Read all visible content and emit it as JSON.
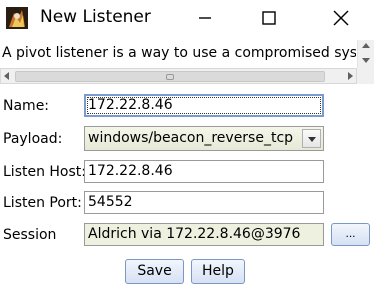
{
  "window": {
    "title": "New Listener",
    "icon": "app-icon",
    "controls": [
      "minimize-icon",
      "maximize-icon",
      "close-icon"
    ]
  },
  "description": {
    "text": "A pivot listener is a way to use a compromised system as"
  },
  "form": {
    "name_label": "Name:",
    "name_value": "172.22.8.46",
    "payload_label": "Payload:",
    "payload_value": "windows/beacon_reverse_tcp",
    "listen_host_label": "Listen Host:",
    "listen_host_value": "172.22.8.46",
    "listen_port_label": "Listen Port:",
    "listen_port_value": "54552",
    "session_label": "Session",
    "session_value": "Aldrich via  172.22.8.46@3976",
    "session_browse_label": "..."
  },
  "buttons": {
    "save_label": "Save",
    "help_label": "Help"
  }
}
